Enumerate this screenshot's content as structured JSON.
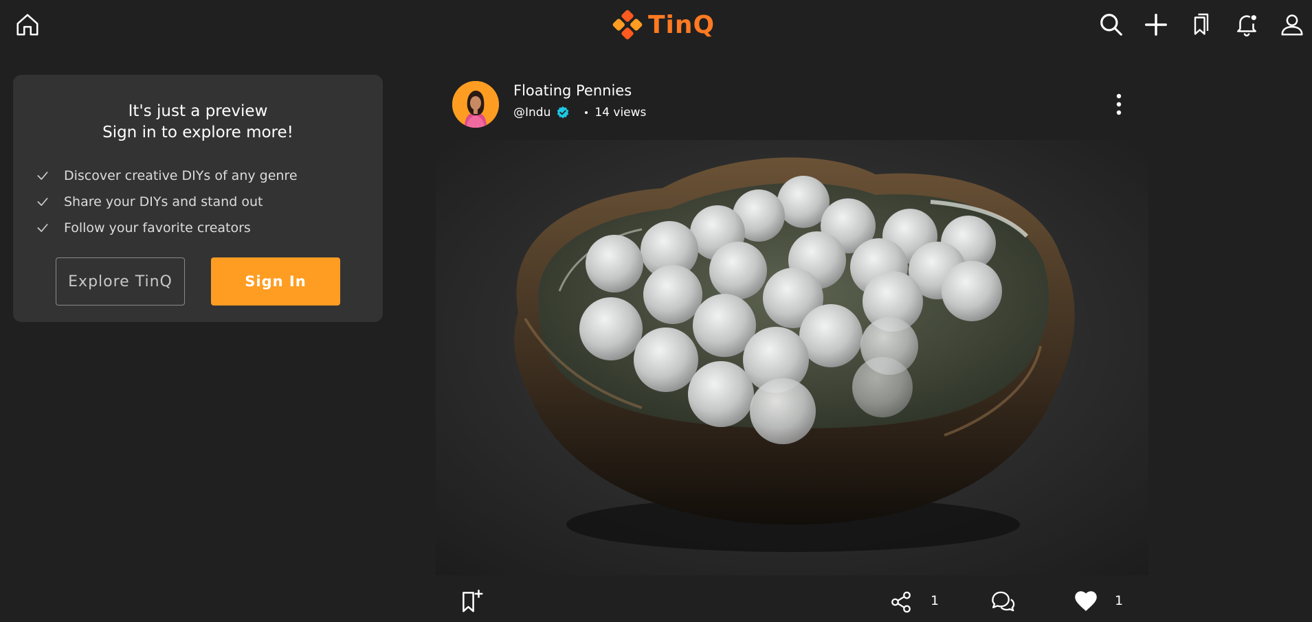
{
  "app": {
    "brand_name": "TinQ",
    "brand_color": "#ff7a22",
    "accent_color": "#ff9d23",
    "background_color": "#202020",
    "card_color": "#333333"
  },
  "topbar": {
    "icons": [
      "home-icon",
      "search-icon",
      "plus-icon",
      "bookmarks-icon",
      "bell-icon",
      "user-icon"
    ]
  },
  "preview_card": {
    "title_line1": "It's just a preview",
    "title_line2": "Sign in to explore more!",
    "benefits": [
      "Discover creative DIYs of any genre",
      "Share your DIYs and stand out",
      "Follow your favorite creators"
    ],
    "explore_label": "Explore TinQ",
    "signin_label": "Sign In"
  },
  "post": {
    "title": "Floating Pennies",
    "username": "@Indu",
    "verified": true,
    "views": "14 views",
    "share_count": "1",
    "like_count": "1"
  }
}
